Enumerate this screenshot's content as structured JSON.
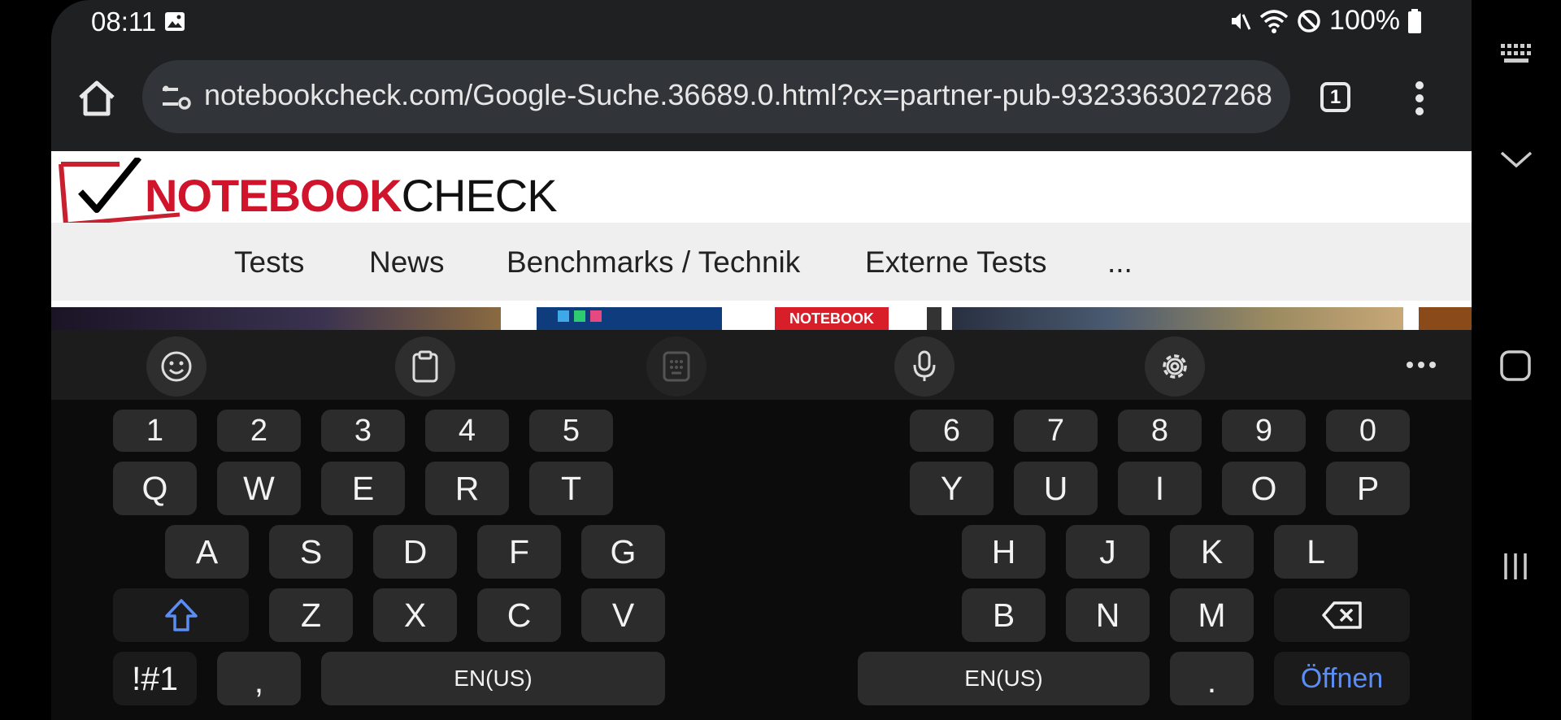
{
  "status_bar": {
    "time": "08:11",
    "battery": "100%"
  },
  "browser": {
    "url": "notebookcheck.com/Google-Suche.36689.0.html?cx=partner-pub-9323363027268",
    "tab_count": "1"
  },
  "site": {
    "logo_red": "NOTEBOOK",
    "logo_black": "CHECK",
    "nav": [
      "Tests",
      "News",
      "Benchmarks / Technik",
      "Externe Tests",
      "..."
    ],
    "thumb_label": "NOTEBOOK CHECK"
  },
  "keyboard": {
    "numbers_left": [
      "1",
      "2",
      "3",
      "4",
      "5"
    ],
    "numbers_right": [
      "6",
      "7",
      "8",
      "9",
      "0"
    ],
    "row1_left": [
      "Q",
      "W",
      "E",
      "R",
      "T"
    ],
    "row1_right": [
      "Y",
      "U",
      "I",
      "O",
      "P"
    ],
    "row2_left": [
      "A",
      "S",
      "D",
      "F",
      "G"
    ],
    "row2_right": [
      "H",
      "J",
      "K",
      "L"
    ],
    "row3_left": [
      "Z",
      "X",
      "C",
      "V"
    ],
    "row3_right": [
      "B",
      "N",
      "M"
    ],
    "symbols_key": "!#1",
    "comma_key": ",",
    "space_left": "EN(US)",
    "space_right": "EN(US)",
    "period_key": ".",
    "action_key": "Öffnen"
  },
  "colors": {
    "accent_blue": "#5b8df5",
    "brand_red": "#d0142c"
  }
}
